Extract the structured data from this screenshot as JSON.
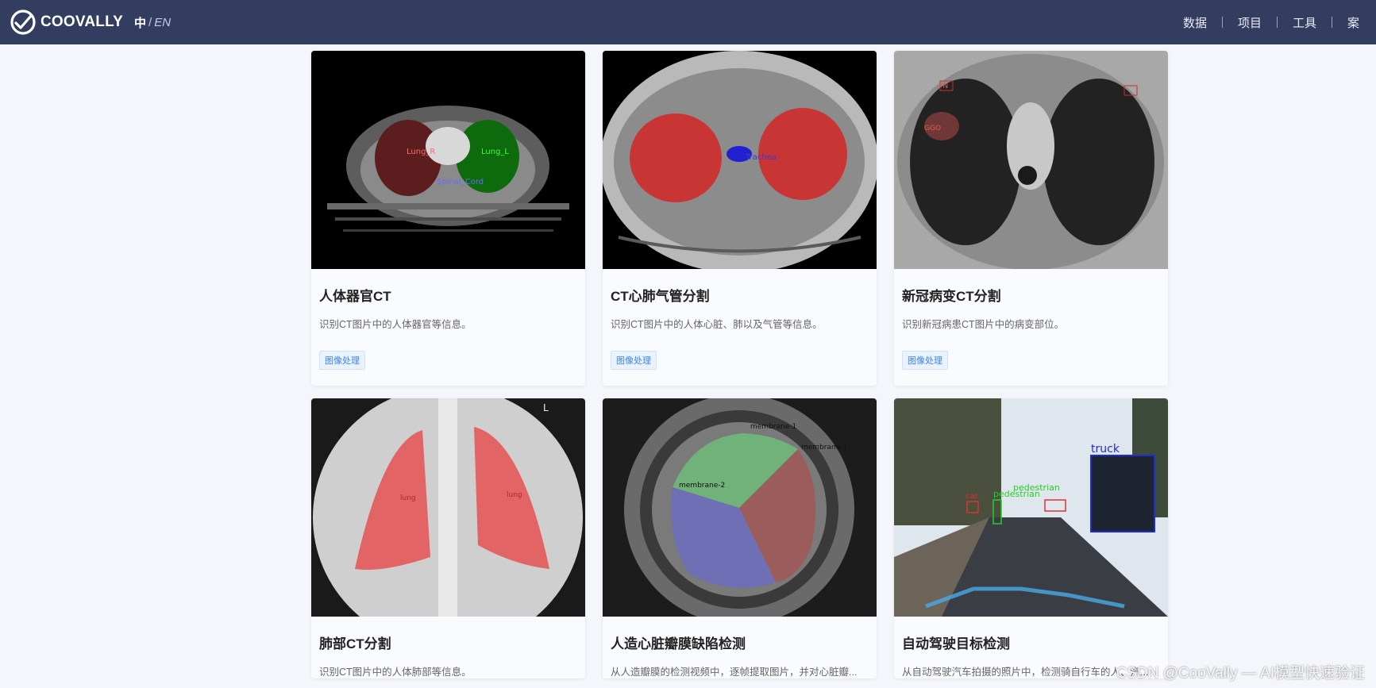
{
  "header": {
    "brand": "COOVALLY",
    "lang_zh": "中",
    "lang_sep": "/",
    "lang_en": "EN",
    "nav": [
      {
        "label": "数据"
      },
      {
        "label": "项目"
      },
      {
        "label": "工具"
      },
      {
        "label": "案"
      }
    ]
  },
  "cards": [
    {
      "title": "人体器官CT",
      "desc": "识别CT图片中的人体器官等信息。",
      "tag": "图像处理",
      "img_labels": [
        "Lung_R",
        "Lung_L",
        "Spinal_Cord"
      ]
    },
    {
      "title": "CT心肺气管分割",
      "desc": "识别CT图片中的人体心脏、肺以及气管等信息。",
      "tag": "图像处理",
      "img_labels": [
        "Trachea"
      ]
    },
    {
      "title": "新冠病变CT分割",
      "desc": "识别新冠病患CT图片中的病变部位。",
      "tag": "图像处理",
      "img_labels": [
        "GGO",
        "PN"
      ]
    },
    {
      "title": "肺部CT分割",
      "desc": "识别CT图片中的人体肺部等信息。",
      "img_labels": [
        "L",
        "lung",
        "lung"
      ]
    },
    {
      "title": "人造心脏瓣膜缺陷检测",
      "desc": "从人造瓣膜的检测视频中，逐帧提取图片，并对心脏瓣...",
      "img_labels": [
        "membrane-1",
        "membrane-1",
        "membrane-2"
      ]
    },
    {
      "title": "自动驾驶目标检测",
      "desc": "从自动驾驶汽车拍摄的照片中，检测骑自行车的人、汽...",
      "img_labels": [
        "truck",
        "car",
        "pedestrian",
        "pedestrian"
      ]
    }
  ],
  "watermark": "CSDN @CooVally — AI模型快速验证",
  "colors": {
    "header_bg": "#333d60",
    "page_bg": "#f4f6fb",
    "tag_text": "#3c84e6"
  }
}
